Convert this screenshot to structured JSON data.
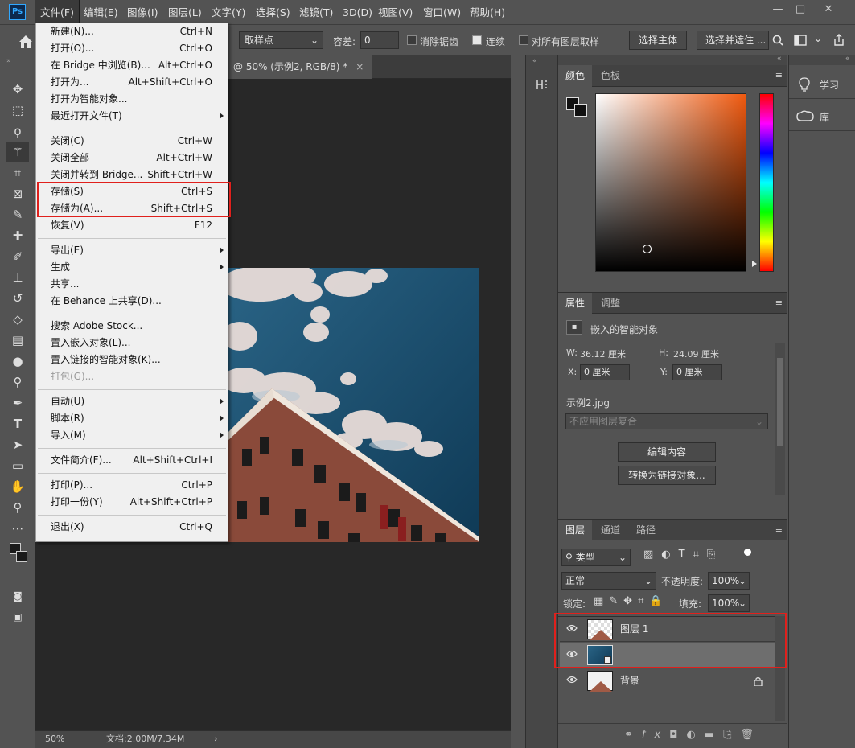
{
  "menubar": {
    "logo": "Ps",
    "items": [
      "文件(F)",
      "编辑(E)",
      "图像(I)",
      "图层(L)",
      "文字(Y)",
      "选择(S)",
      "滤镜(T)",
      "3D(D)",
      "视图(V)",
      "窗口(W)",
      "帮助(H)"
    ],
    "window_controls": [
      "—",
      "□",
      "✕"
    ]
  },
  "options": {
    "sample_label": "取样点",
    "tolerance_label": "容差:",
    "tolerance_value": "0",
    "antialias_label": "消除锯齿",
    "contiguous_label": "连续",
    "all_layers_label": "对所有图层取样",
    "select_subject": "选择主体",
    "select_mask": "选择并遮住 ..."
  },
  "document": {
    "tab_title": "@ 50% (示例2, RGB/8) *",
    "tab_close": "×",
    "zoom": "50%",
    "doc_info": "文档:2.00M/7.34M"
  },
  "file_menu": {
    "groups": [
      [
        {
          "label": "新建(N)...",
          "shortcut": "Ctrl+N"
        },
        {
          "label": "打开(O)...",
          "shortcut": "Ctrl+O"
        },
        {
          "label": "在 Bridge 中浏览(B)...",
          "shortcut": "Alt+Ctrl+O"
        },
        {
          "label": "打开为...",
          "shortcut": "Alt+Shift+Ctrl+O"
        },
        {
          "label": "打开为智能对象...",
          "shortcut": ""
        },
        {
          "label": "最近打开文件(T)",
          "shortcut": "",
          "submenu": true
        }
      ],
      [
        {
          "label": "关闭(C)",
          "shortcut": "Ctrl+W"
        },
        {
          "label": "关闭全部",
          "shortcut": "Alt+Ctrl+W"
        },
        {
          "label": "关闭并转到 Bridge...",
          "shortcut": "Shift+Ctrl+W"
        },
        {
          "label": "存储(S)",
          "shortcut": "Ctrl+S"
        },
        {
          "label": "存储为(A)...",
          "shortcut": "Shift+Ctrl+S"
        },
        {
          "label": "恢复(V)",
          "shortcut": "F12"
        }
      ],
      [
        {
          "label": "导出(E)",
          "shortcut": "",
          "submenu": true
        },
        {
          "label": "生成",
          "shortcut": "",
          "submenu": true
        },
        {
          "label": "共享...",
          "shortcut": ""
        },
        {
          "label": "在 Behance 上共享(D)...",
          "shortcut": ""
        }
      ],
      [
        {
          "label": "搜索 Adobe Stock...",
          "shortcut": ""
        },
        {
          "label": "置入嵌入对象(L)...",
          "shortcut": ""
        },
        {
          "label": "置入链接的智能对象(K)...",
          "shortcut": ""
        },
        {
          "label": "打包(G)...",
          "shortcut": "",
          "disabled": true
        }
      ],
      [
        {
          "label": "自动(U)",
          "shortcut": "",
          "submenu": true
        },
        {
          "label": "脚本(R)",
          "shortcut": "",
          "submenu": true
        },
        {
          "label": "导入(M)",
          "shortcut": "",
          "submenu": true
        }
      ],
      [
        {
          "label": "文件简介(F)...",
          "shortcut": "Alt+Shift+Ctrl+I"
        }
      ],
      [
        {
          "label": "打印(P)...",
          "shortcut": "Ctrl+P"
        },
        {
          "label": "打印一份(Y)",
          "shortcut": "Alt+Shift+Ctrl+P"
        }
      ],
      [
        {
          "label": "退出(X)",
          "shortcut": "Ctrl+Q"
        }
      ]
    ]
  },
  "color_panel": {
    "tabs": [
      "颜色",
      "色板"
    ],
    "menu_icon": "≡",
    "hue_color": "#f05a10"
  },
  "properties_panel": {
    "tabs": [
      "属性",
      "调整"
    ],
    "type_label": "嵌入的智能对象",
    "w_label": "W:",
    "w_value": "36.12 厘米",
    "h_label": "H:",
    "h_value": "24.09 厘米",
    "x_label": "X:",
    "x_value": "0 厘米",
    "y_label": "Y:",
    "y_value": "0 厘米",
    "filename": "示例2.jpg",
    "comp_placeholder": "不应用图层复合",
    "edit_contents": "编辑内容",
    "convert_linked": "转换为链接对象..."
  },
  "layers_panel": {
    "tabs": [
      "图层",
      "通道",
      "路径"
    ],
    "filter_label": "类型",
    "blend_mode": "正常",
    "opacity_label": "不透明度:",
    "opacity_value": "100%",
    "lock_label": "锁定:",
    "fill_label": "填充:",
    "fill_value": "100%",
    "layers": [
      {
        "name": "图层 1"
      },
      {
        "name": ""
      },
      {
        "name": "背景"
      }
    ],
    "footer_icons": [
      "link-icon",
      "fx-icon",
      "mask-icon",
      "adjustment-icon",
      "folder-icon",
      "new-layer-icon",
      "trash-icon"
    ]
  },
  "learn_panel": {
    "learn_label": "学习",
    "library_label": "库"
  }
}
